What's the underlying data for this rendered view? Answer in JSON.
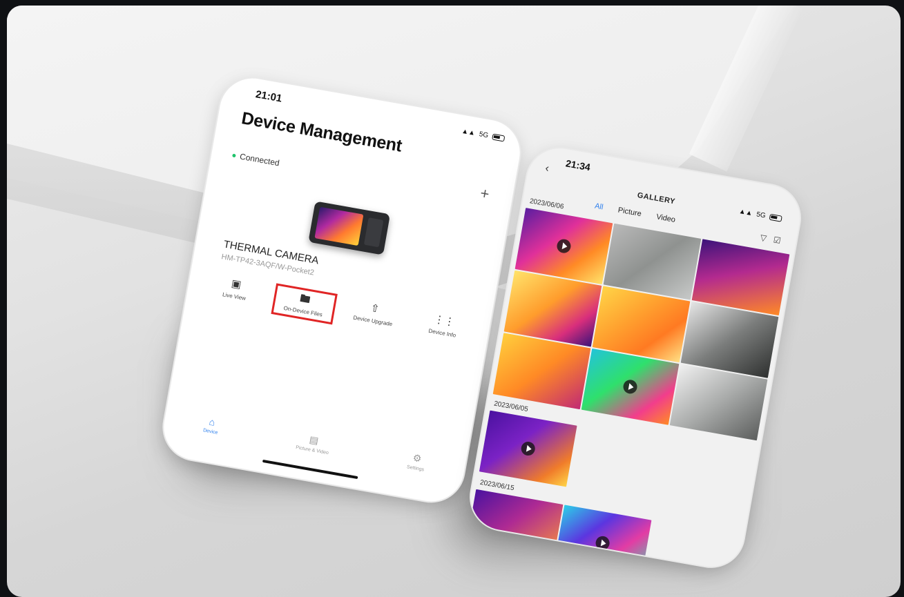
{
  "phone_left": {
    "status_time": "21:01",
    "status_network": "5G",
    "title": "Device Management",
    "connection_status": "Connected",
    "add_icon": "plus-icon",
    "device": {
      "name": "THERMAL CAMERA",
      "model": "HM-TP42-3AQF/W-Pocket2"
    },
    "actions": [
      {
        "label": "Live View",
        "icon": "live-view-icon"
      },
      {
        "label": "On-Device Files",
        "icon": "folder-icon",
        "highlighted": true
      },
      {
        "label": "Device Upgrade",
        "icon": "upgrade-icon"
      },
      {
        "label": "Device Info",
        "icon": "info-icon"
      }
    ],
    "tabs": [
      {
        "label": "Device",
        "icon": "home-icon",
        "active": true
      },
      {
        "label": "Picture & Video",
        "icon": "picture-icon"
      },
      {
        "label": "Settings",
        "icon": "settings-icon"
      }
    ],
    "highlight_color": "#e02525",
    "accent_color": "#2f80ed"
  },
  "phone_right": {
    "status_time": "21:34",
    "status_network": "5G",
    "title": "GALLERY",
    "tabs": [
      {
        "label": "All",
        "active": true
      },
      {
        "label": "Picture"
      },
      {
        "label": "Video"
      }
    ],
    "groups": [
      {
        "date": "2023/06/06",
        "count": 9
      },
      {
        "date": "2023/06/05",
        "count": 1
      },
      {
        "date": "2023/06/15",
        "count": 2
      }
    ]
  }
}
